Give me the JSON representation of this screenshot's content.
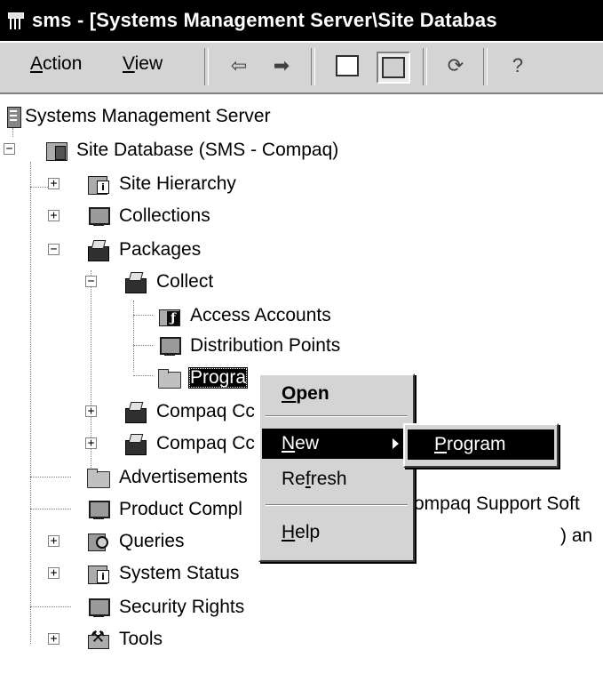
{
  "window": {
    "title": "sms - [Systems Management Server\\Site Databas"
  },
  "toolbar": {
    "menu": [
      {
        "pre": "",
        "ul": "A",
        "post": "ction"
      },
      {
        "pre": "",
        "ul": "V",
        "post": "iew"
      }
    ],
    "buttons": [
      {
        "name": "back-icon",
        "glyph": "⇦"
      },
      {
        "name": "forward-icon",
        "glyph": "➡"
      },
      {
        "name": "up-one-level-icon",
        "glyph": "⮤"
      },
      {
        "name": "show-hide-tree-icon",
        "glyph": ""
      },
      {
        "name": "refresh-icon",
        "glyph": "⟳"
      },
      {
        "name": "help-icon",
        "glyph": "?"
      }
    ]
  },
  "tree": {
    "root": "Systems Management Server",
    "site_database": "Site Database (SMS - Compaq)",
    "site_hierarchy": "Site Hierarchy",
    "collections": "Collections",
    "packages": "Packages",
    "collect": "Collect",
    "access_accounts": "Access Accounts",
    "distribution_points": "Distribution Points",
    "programs": "Progra",
    "compaq_1": "Compaq Cc",
    "compaq_1_rest": "ompaq Support Soft",
    "compaq_2": "Compaq Cc",
    "compaq_2_rest": ") an",
    "advertisements": "Advertisements",
    "product_compliance": "Product Compl",
    "queries": "Queries",
    "system_status": "System Status",
    "security_rights": "Security Rights",
    "tools": "Tools"
  },
  "context_menu": {
    "open": {
      "ul": "O",
      "post": "pen"
    },
    "new": {
      "ul": "N",
      "post": "ew"
    },
    "refresh": {
      "pre": "Re",
      "ul": "f",
      "post": "resh"
    },
    "help": {
      "ul": "H",
      "post": "elp"
    }
  },
  "submenu": {
    "program": {
      "ul": "P",
      "post": "rogram"
    }
  }
}
